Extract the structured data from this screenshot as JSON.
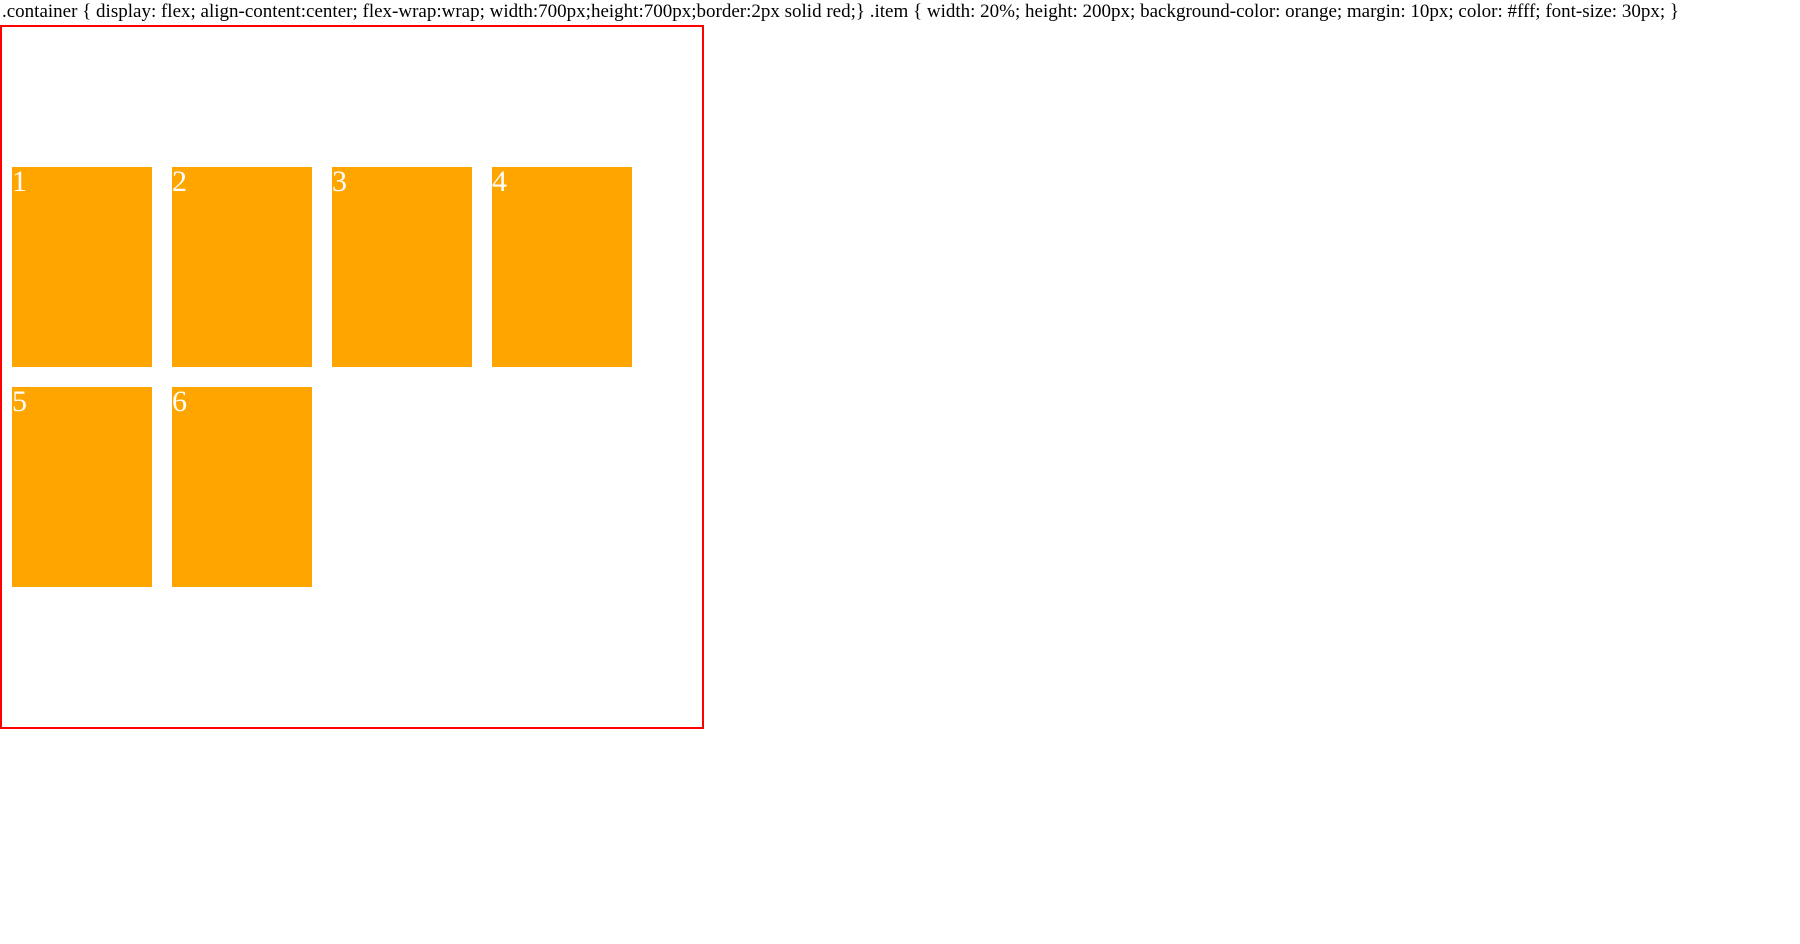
{
  "css_text": ".container { display: flex; align-content:center; flex-wrap:wrap; width:700px;height:700px;border:2px solid red;} .item { width: 20%; height: 200px; background-color: orange; margin: 10px; color: #fff; font-size: 30px; }",
  "items": {
    "i1": "1",
    "i2": "2",
    "i3": "3",
    "i4": "4",
    "i5": "5",
    "i6": "6"
  }
}
